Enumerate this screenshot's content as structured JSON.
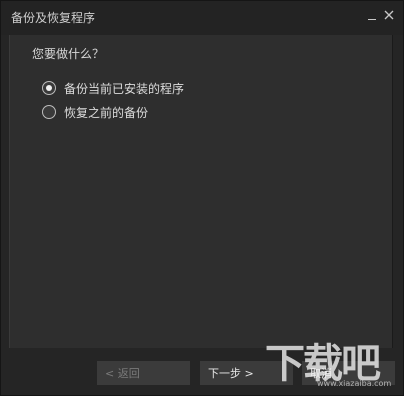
{
  "window": {
    "title": "备份及恢复程序"
  },
  "content": {
    "question": "您要做什么？",
    "options": [
      {
        "label": "备份当前已安装的程序",
        "selected": true
      },
      {
        "label": "恢复之前的备份",
        "selected": false
      }
    ]
  },
  "footer": {
    "back_label": "< 返回",
    "next_label": "下一步 >",
    "cancel_label": "取消"
  },
  "watermark": {
    "text": "下载吧",
    "url": "www.xiazaiba.com"
  },
  "icons": {
    "minimize": "minimize-icon",
    "close": "close-icon",
    "radio_selected": "radio-selected-icon",
    "radio_unselected": "radio-unselected-icon"
  }
}
